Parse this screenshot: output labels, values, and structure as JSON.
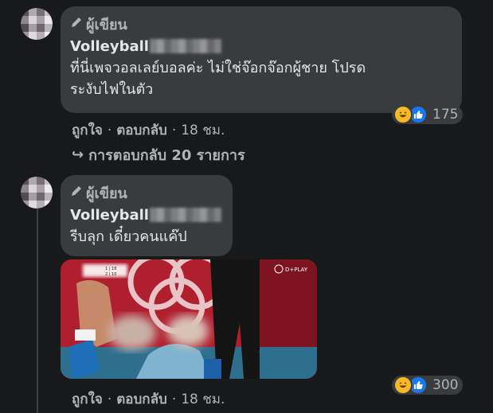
{
  "comments": [
    {
      "author_badge": "ผู้เขียน",
      "name": "Volleyball",
      "text_line1": "ที่นี่เพจวอลเลย์บอลค่ะ ไม่ใช่จ๊อกจ๊อกผู้ชาย โปรด",
      "text_line2": "ระงับไฟในตัว",
      "reaction_count": "175",
      "like_label": "ถูกใจ",
      "reply_label": "ตอบกลับ",
      "time": "18 ชม.",
      "separator": "·"
    },
    {
      "author_badge": "ผู้เขียน",
      "name": "Volleyball",
      "text_line1": "รีบลุก เดี๋ยวคนแค๊ป",
      "reaction_count": "300",
      "like_label": "ถูกใจ",
      "reply_label": "ตอบกลับ",
      "time": "18 ชม.",
      "separator": "·"
    }
  ],
  "view_replies": {
    "arrow": "↪",
    "label": "การตอบกลับ 20 รายการ"
  },
  "media": {
    "scoreboard_row1": "1 | 18",
    "scoreboard_row2": "2 | 10",
    "channel_logo": "D+PLAY"
  },
  "colors": {
    "background": "#18191a",
    "bubble": "#3a3b3c",
    "text_primary": "#e4e6eb",
    "text_secondary": "#b0b3b8",
    "like_blue": "#1877f2",
    "haha_yellow": "#f7b928"
  },
  "icons": {
    "author_badge": "pencil-icon",
    "reaction_haha": "haha-emoji-icon",
    "reaction_like": "like-thumb-icon",
    "reply_arrow": "reply-arrow-icon"
  }
}
